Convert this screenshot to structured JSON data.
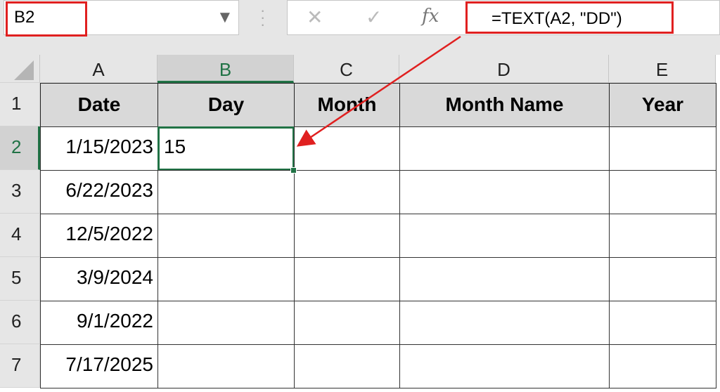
{
  "name_box": "B2",
  "formula_bar": {
    "cancel": "✕",
    "enter": "✓",
    "fx": "fx",
    "formula": "=TEXT(A2, \"DD\")"
  },
  "columns": [
    "A",
    "B",
    "C",
    "D",
    "E"
  ],
  "rows": [
    "1",
    "2",
    "3",
    "4",
    "5",
    "6",
    "7"
  ],
  "headers": [
    "Date",
    "Day",
    "Month",
    "Month Name",
    "Year"
  ],
  "dates": [
    "1/15/2023",
    "6/22/2023",
    "12/5/2022",
    "3/9/2024",
    "9/1/2022",
    "7/17/2025"
  ],
  "b2": "15",
  "colors": {
    "highlight": "#e02020",
    "selection": "#217346"
  }
}
